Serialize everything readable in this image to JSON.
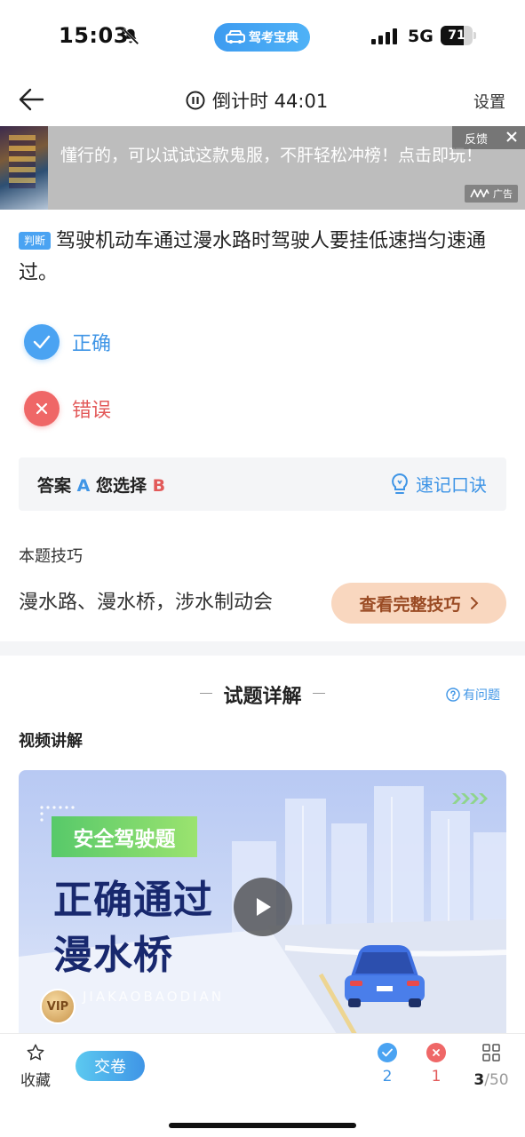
{
  "status_bar": {
    "time": "15:03",
    "app_label": "驾考宝典",
    "network": "5G",
    "battery_level": "71",
    "battery_fraction": 0.71
  },
  "nav": {
    "timer_label": "倒计时 44:01",
    "settings_label": "设置"
  },
  "ad": {
    "text": "懂行的，可以试试这款鬼服，不肝轻松冲榜！点击即玩！",
    "feedback_label": "反馈",
    "badge_label": "广告"
  },
  "question": {
    "type_tag": "判断",
    "text": "驾驶机动车通过漫水路时驾驶人要挂低速挡匀速通过。",
    "options": [
      {
        "label": "正确",
        "state": "correct",
        "icon": "check-icon"
      },
      {
        "label": "错误",
        "state": "wrong",
        "icon": "close-icon"
      }
    ]
  },
  "answer": {
    "answer_label": "答案",
    "answer_value": "A",
    "choice_label": "您选择",
    "choice_value": "B",
    "memo_label": "速记口诀"
  },
  "skill": {
    "title": "本题技巧",
    "text": "漫水路、漫水桥，涉水制动会",
    "button_label": "查看完整技巧"
  },
  "detail": {
    "title": "试题详解",
    "ask_label": "有问题",
    "video_label": "视频讲解",
    "video": {
      "tag": "安全驾驶题",
      "title_line1": "正确通过",
      "title_line2": "漫水桥",
      "watermark": "JIAKAOBAODIAN",
      "vip_badge": "VIP"
    }
  },
  "bottom_bar": {
    "favorite_label": "收藏",
    "submit_label": "交卷",
    "correct_count": "2",
    "wrong_count": "1",
    "current_index": "3",
    "total_label": "/50"
  },
  "colors": {
    "accent_blue": "#3f95e6",
    "error_red": "#e25a5a",
    "skill_button_bg": "#f9d7bf",
    "video_title": "#18286e"
  }
}
